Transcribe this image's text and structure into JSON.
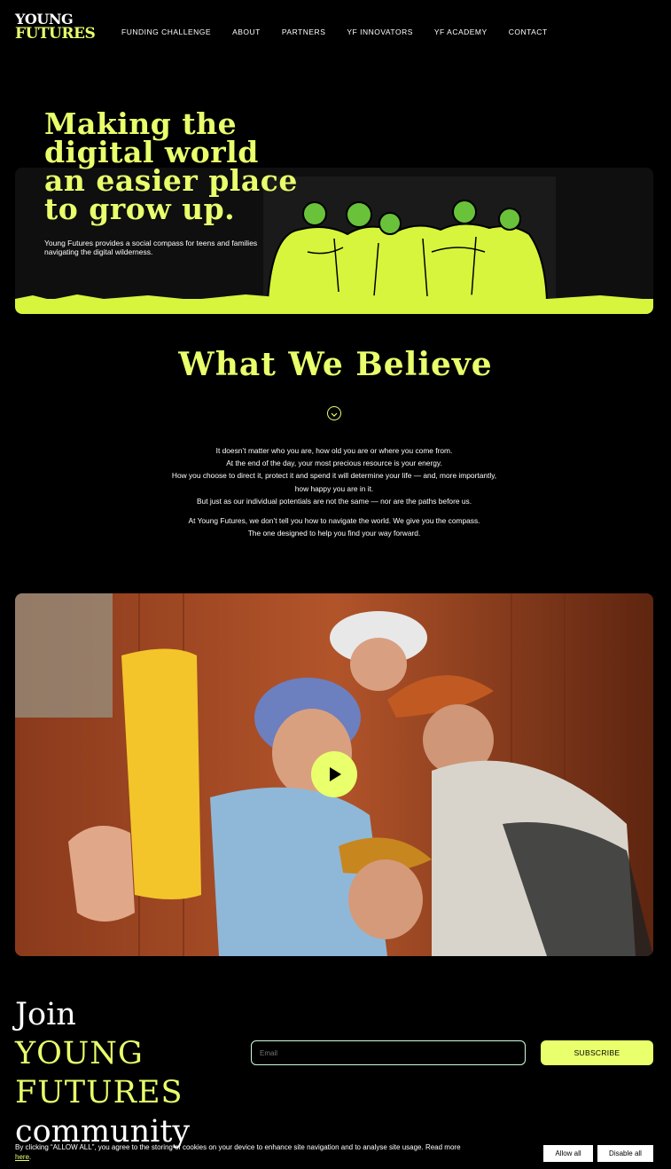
{
  "logo": {
    "line1": "YOUNG",
    "line2": "FUTURES"
  },
  "nav": [
    "FUNDING CHALLENGE",
    "ABOUT",
    "PARTNERS",
    "YF INNOVATORS",
    "YF ACADEMY",
    "CONTACT"
  ],
  "hero": {
    "title": "Making the digital world an easier place to grow up.",
    "subtitle": "Young Futures provides a social compass for teens and families navigating the digital wilderness."
  },
  "believe": {
    "title": "What We Believe",
    "lines": [
      "It doesn’t matter who you are, how old you are or where you come from.",
      "At the end of the day, your most precious resource is your energy.",
      "How you choose to direct it, protect it and spend it will determine your life — and, more importantly, how happy you are in it.",
      "But just as our individual potentials are not the same — nor are the paths before us."
    ],
    "lines2": [
      "At Young Futures, we don’t tell you how to navigate the world. We give you the compass.",
      "The one designed to help you find your way forward."
    ]
  },
  "join": {
    "line1": "Join",
    "line2": "YOUNG FUTURES",
    "line3": "community"
  },
  "newsletter": {
    "email_placeholder": "Email",
    "subscribe_label": "SUBSCRIBE"
  },
  "cookie": {
    "text": "By clicking “ALLOW ALL”, you agree to the storing of cookies on your device to enhance site navigation and to analyse site usage. Read more ",
    "link": "here",
    "end": ".",
    "allow_label": "Allow all",
    "disable_label": "Disable all"
  },
  "colors": {
    "accent": "#e9ff6b",
    "background": "#000000"
  },
  "icons": {
    "scroll": "chevron-down-icon",
    "video": "play-icon"
  }
}
